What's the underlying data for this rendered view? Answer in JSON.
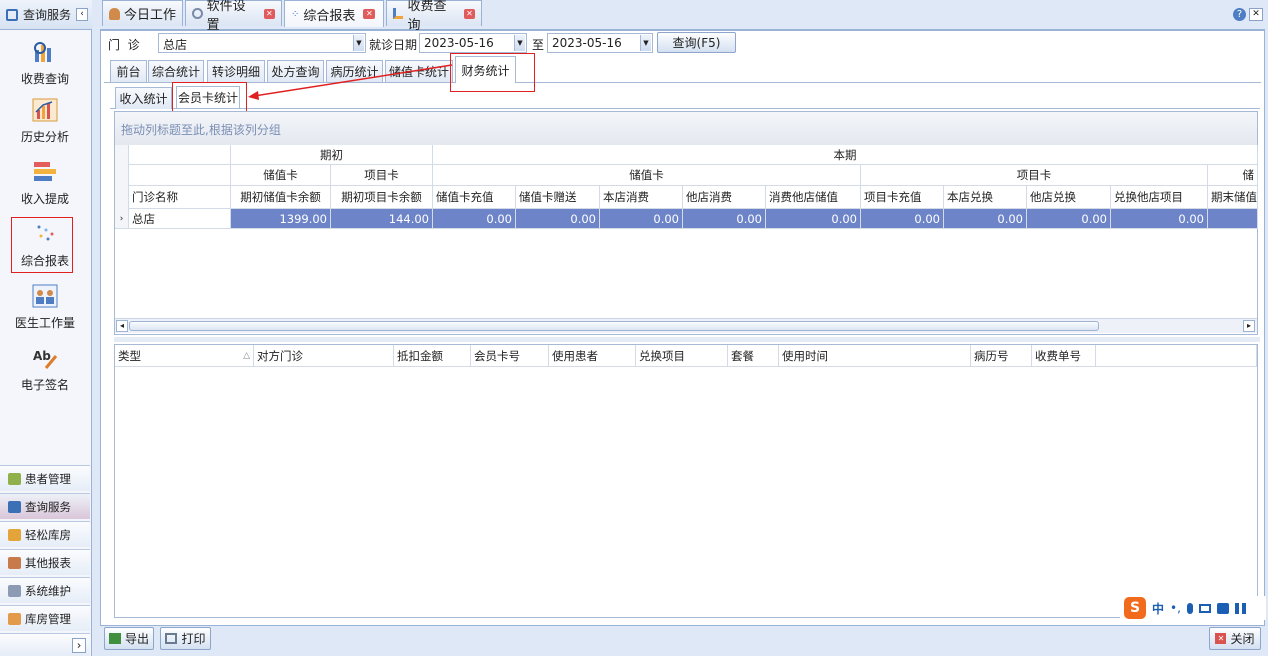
{
  "left": {
    "header": "查询服务",
    "collapse_glyph": "‹",
    "items": [
      {
        "label": "收费查询",
        "icon": "chart-search-icon"
      },
      {
        "label": "历史分析",
        "icon": "bar-chart-icon"
      },
      {
        "label": "收入提成",
        "icon": "stack-icon"
      },
      {
        "label": "综合报表",
        "icon": "dots-report-icon"
      },
      {
        "label": "医生工作量",
        "icon": "doctors-icon"
      },
      {
        "label": "电子签名",
        "icon": "signature-icon"
      }
    ],
    "bottom": [
      {
        "label": "患者管理",
        "icon": "patients-icon"
      },
      {
        "label": "查询服务",
        "icon": "query-icon"
      },
      {
        "label": "轻松库房",
        "icon": "warehouse-icon"
      },
      {
        "label": "其他报表",
        "icon": "report-icon"
      },
      {
        "label": "系统维护",
        "icon": "maintenance-icon"
      },
      {
        "label": "库房管理",
        "icon": "store-icon"
      }
    ],
    "more_glyph": "›"
  },
  "tabs": [
    {
      "label": "今日工作"
    },
    {
      "label": "软件设置"
    },
    {
      "label": "综合报表"
    },
    {
      "label": "收费查询"
    }
  ],
  "filter": {
    "clinic_label": "门  诊",
    "clinic_value": "总店",
    "date_label": "就诊日期",
    "date_from": "2023-05-16",
    "to_label": "至",
    "date_to": "2023-05-16",
    "query_button": "查询(F5)"
  },
  "subtabs": [
    "前台",
    "综合统计",
    "转诊明细",
    "处方查询",
    "病历统计",
    "储值卡统计",
    "财务统计"
  ],
  "subsubtabs": [
    "收入统计",
    "会员卡统计"
  ],
  "group_hint": "拖动列标题至此,根据该列分组",
  "grid": {
    "band1": [
      "期初",
      "本期"
    ],
    "band2": [
      "储值卡",
      "项目卡",
      "储值卡",
      "项目卡",
      "储"
    ],
    "columns": [
      "门诊名称",
      "期初储值卡余额",
      "期初项目卡余额",
      "储值卡充值",
      "储值卡赠送",
      "本店消费",
      "他店消费",
      "消费他店储值",
      "项目卡充值",
      "本店兑换",
      "他店兑换",
      "兑换他店项目",
      "期末储值"
    ],
    "row": [
      "总店",
      "1399.00",
      "144.00",
      "0.00",
      "0.00",
      "0.00",
      "0.00",
      "0.00",
      "0.00",
      "0.00",
      "0.00",
      "0.00",
      ""
    ]
  },
  "detail_columns": [
    "类型",
    "对方门诊",
    "抵扣金额",
    "会员卡号",
    "使用患者",
    "兑换项目",
    "套餐",
    "使用时间",
    "病历号",
    "收费单号"
  ],
  "footer": {
    "export": "导出",
    "print": "打印",
    "close": "关闭"
  },
  "ime": {
    "label": "中"
  },
  "colors": {
    "accent": "#6d84c8",
    "annotation": "#e02020"
  }
}
